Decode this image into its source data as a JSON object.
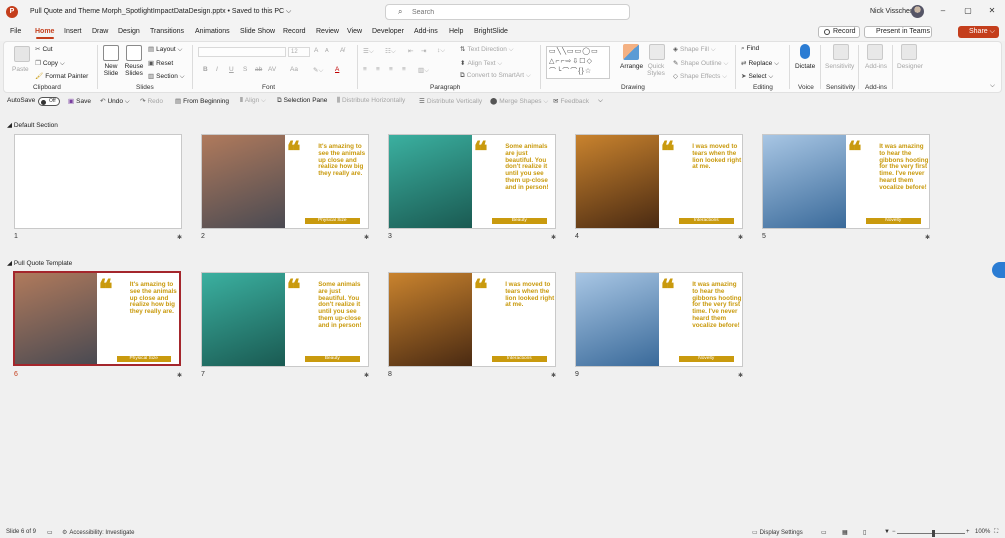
{
  "app": {
    "logo_letter": "P",
    "title": "Pull Quote and Theme Morph_SpotlightImpactDataDesign.pptx • Saved to this PC ⌵"
  },
  "search": {
    "placeholder": "Search"
  },
  "user": {
    "name": "Nick Visscher"
  },
  "window_controls": {
    "minimize": "–",
    "maximize": "▢",
    "close": "✕"
  },
  "menu": {
    "tabs": [
      "File",
      "Home",
      "Insert",
      "Draw",
      "Design",
      "Transitions",
      "Animations",
      "Slide Show",
      "Record",
      "Review",
      "View",
      "Developer",
      "Add-ins",
      "Help",
      "BrightSlide"
    ],
    "active": "Home",
    "record_label": "Record",
    "present_label": "Present in Teams",
    "share_label": "Share"
  },
  "ribbon": {
    "clipboard": {
      "paste": "Paste",
      "cut": "Cut",
      "copy": "Copy",
      "format_painter": "Format Painter",
      "label": "Clipboard"
    },
    "slides": {
      "new_slide": "New Slide",
      "reuse_slides": "Reuse Slides",
      "layout": "Layout",
      "reset": "Reset",
      "section": "Section",
      "label": "Slides"
    },
    "font": {
      "size": "12",
      "label": "Font",
      "bold": "B",
      "italic": "I",
      "underline": "U",
      "strike": "S",
      "shadow": "ab",
      "spacing": "AV",
      "grow": "A",
      "shrink": "A",
      "case": "Aa"
    },
    "paragraph": {
      "text_direction": "Text Direction",
      "align_text": "Align Text",
      "convert_smartart": "Convert to SmartArt",
      "label": "Paragraph"
    },
    "drawing": {
      "arrange": "Arrange",
      "quick_styles": "Quick Styles",
      "shape_fill": "Shape Fill",
      "shape_outline": "Shape Outline",
      "shape_effects": "Shape Effects",
      "label": "Drawing"
    },
    "editing": {
      "find": "Find",
      "replace": "Replace",
      "select": "Select",
      "label": "Editing"
    },
    "voice": {
      "dictate": "Dictate",
      "label": "Voice"
    },
    "sensitivity": {
      "button": "Sensitivity",
      "label": "Sensitivity"
    },
    "addins": {
      "button": "Add-ins",
      "label": "Add-ins"
    },
    "designer": {
      "button": "Designer"
    }
  },
  "qat": {
    "autosave": "AutoSave",
    "autosave_state": "Off",
    "save": "Save",
    "undo": "Undo",
    "redo": "Redo",
    "from_beginning": "From Beginning",
    "align": "Align",
    "selection_pane": "Selection Pane",
    "distribute_h": "Distribute Horizontally",
    "distribute_v": "Distribute Vertically",
    "merge_shapes": "Merge Shapes",
    "feedback": "Feedback"
  },
  "sections": [
    {
      "title": "Default Section"
    },
    {
      "title": "Pull Quote Template"
    }
  ],
  "slides": [
    {
      "number": "1",
      "blank": true
    },
    {
      "number": "2",
      "quote": "It's amazing to see the animals up close and realize how big they really are.",
      "tag": "Physical Size",
      "colors": [
        "#4a4a52",
        "#b07a5c"
      ]
    },
    {
      "number": "3",
      "quote": "Some animals are just beautiful. You don't realize it until you see them up-close and in person!",
      "tag": "Beauty",
      "colors": [
        "#1a5a52",
        "#3bb0a0"
      ]
    },
    {
      "number": "4",
      "quote": "I was moved to tears when the lion looked right at me.",
      "tag": "Interactions",
      "colors": [
        "#4a2a12",
        "#c9832e"
      ]
    },
    {
      "number": "5",
      "quote": "It was amazing to hear the gibbons hooting for the very first time. I've never heard them vocalize before!",
      "tag": "Novelty",
      "colors": [
        "#3a6a9a",
        "#a8c6e4"
      ]
    },
    {
      "number": "6",
      "quote": "It's amazing to see the animals up close and realize how big they really are.",
      "tag": "Physical Size",
      "colors": [
        "#4a4a52",
        "#b07a5c"
      ],
      "selected": true
    },
    {
      "number": "7",
      "quote": "Some animals are just beautiful. You don't realize it until you see them up-close and in person!",
      "tag": "Beauty",
      "colors": [
        "#1a5a52",
        "#3bb0a0"
      ]
    },
    {
      "number": "8",
      "quote": "I was moved to tears when the lion looked right at me.",
      "tag": "Interactions",
      "colors": [
        "#4a2a12",
        "#c9832e"
      ]
    },
    {
      "number": "9",
      "quote": "It was amazing to hear the gibbons hooting for the very first time. I've never heard them vocalize before!",
      "tag": "Novelty",
      "colors": [
        "#3a6a9a",
        "#a8c6e4"
      ]
    }
  ],
  "status": {
    "slide_of": "Slide 6 of 9",
    "accessibility": "Accessibility: Investigate",
    "display_settings": "Display Settings",
    "zoom": "100%"
  },
  "colors": {
    "accent": "#c43e1c",
    "quote_gold": "#c99a0e",
    "selection": "#a4262c"
  }
}
